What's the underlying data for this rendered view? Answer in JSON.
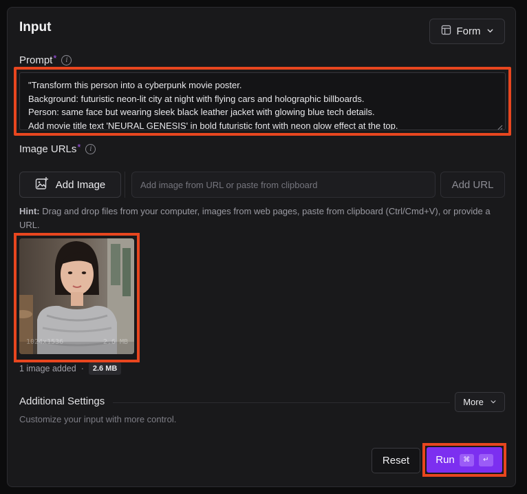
{
  "header": {
    "title": "Input",
    "view_mode": "Form"
  },
  "prompt": {
    "label": "Prompt",
    "required_mark": "*",
    "lines": [
      "\"Transform this person into a cyberpunk movie poster.",
      "Background: futuristic neon-lit city at night with flying cars and holographic billboards.",
      "Person: same face but wearing sleek black leather jacket with glowing blue tech details.",
      "Add movie title text 'NEURAL GENESIS' in bold futuristic font with neon glow effect at the top."
    ]
  },
  "image_urls": {
    "label": "Image URLs",
    "required_mark": "*",
    "add_image_label": "Add Image",
    "url_placeholder": "Add image from URL or paste from clipboard",
    "add_url_label": "Add URL",
    "hint_prefix": "Hint:",
    "hint_text": " Drag and drop files from your computer, images from web pages, paste from clipboard (Ctrl/Cmd+V), or provide a URL.",
    "thumbnail": {
      "dimensions": "1024x1536",
      "size": "2.6 MB"
    },
    "count_text": "1 image added",
    "separator": "·",
    "total_size": "2.6 MB"
  },
  "settings": {
    "title": "Additional Settings",
    "more_label": "More",
    "subtitle": "Customize your input with more control."
  },
  "actions": {
    "reset_label": "Reset",
    "run_label": "Run",
    "shortcut_keys": [
      "⌘",
      "↵"
    ]
  },
  "colors": {
    "accent": "#7c2ff0",
    "highlight": "#e8461f",
    "required": "#a855f7"
  }
}
